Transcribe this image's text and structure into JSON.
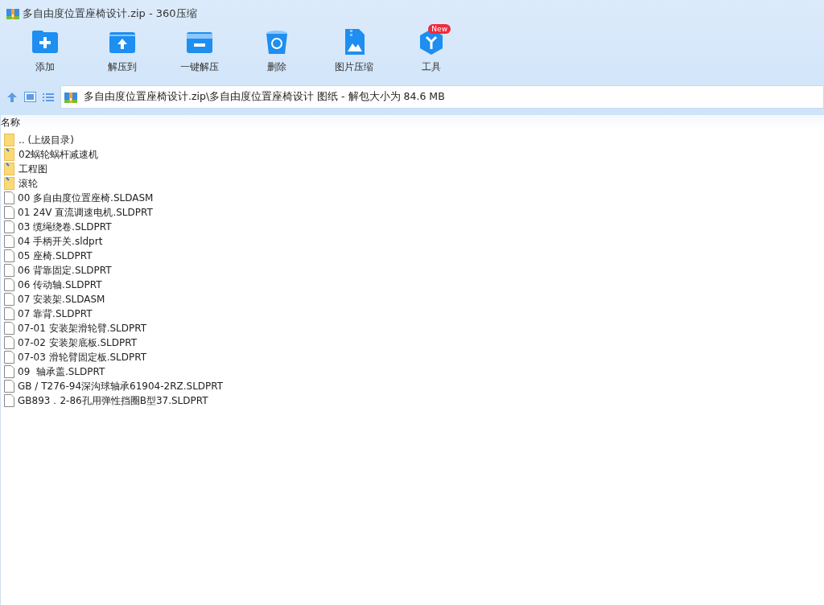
{
  "window": {
    "title": "多自由度位置座椅设计.zip - 360压缩"
  },
  "toolbar": [
    {
      "kind": "add",
      "label": "添加"
    },
    {
      "kind": "extract",
      "label": "解压到"
    },
    {
      "kind": "oneclick",
      "label": "一键解压"
    },
    {
      "kind": "delete",
      "label": "删除"
    },
    {
      "kind": "image",
      "label": "图片压缩"
    },
    {
      "kind": "tools",
      "label": "工具",
      "badge": "New"
    }
  ],
  "address": {
    "path": "多自由度位置座椅设计.zip\\多自由度位置座椅设计 图纸 - 解包大小为 84.6 MB"
  },
  "list": {
    "columns": [
      "名称"
    ],
    "rows": [
      {
        "kind": "parent",
        "name": ".. (上级目录)"
      },
      {
        "kind": "folder",
        "name": "02蜗轮蜗杆减速机"
      },
      {
        "kind": "folder",
        "name": "工程图"
      },
      {
        "kind": "folder",
        "name": "滚轮"
      },
      {
        "kind": "file",
        "name": "00 多自由度位置座椅.SLDASM"
      },
      {
        "kind": "file",
        "name": "01 24V 直流调速电机.SLDPRT"
      },
      {
        "kind": "file",
        "name": "03 缆绳绕卷.SLDPRT"
      },
      {
        "kind": "file",
        "name": "04 手柄开关.sldprt"
      },
      {
        "kind": "file",
        "name": "05 座椅.SLDPRT"
      },
      {
        "kind": "file",
        "name": "06 背靠固定.SLDPRT"
      },
      {
        "kind": "file",
        "name": "06 传动轴.SLDPRT"
      },
      {
        "kind": "file",
        "name": "07 安装架.SLDASM"
      },
      {
        "kind": "file",
        "name": "07 靠背.SLDPRT"
      },
      {
        "kind": "file",
        "name": "07-01 安装架滑轮臂.SLDPRT"
      },
      {
        "kind": "file",
        "name": "07-02 安装架底板.SLDPRT"
      },
      {
        "kind": "file",
        "name": "07-03 滑轮臂固定板.SLDPRT"
      },
      {
        "kind": "file",
        "name": "09  轴承盖.SLDPRT"
      },
      {
        "kind": "file",
        "name": "GB / T276-94深沟球轴承61904-2RZ.SLDPRT"
      },
      {
        "kind": "file",
        "name": "GB893．2-86孔用弹性挡圈B型37.SLDPRT"
      }
    ]
  }
}
